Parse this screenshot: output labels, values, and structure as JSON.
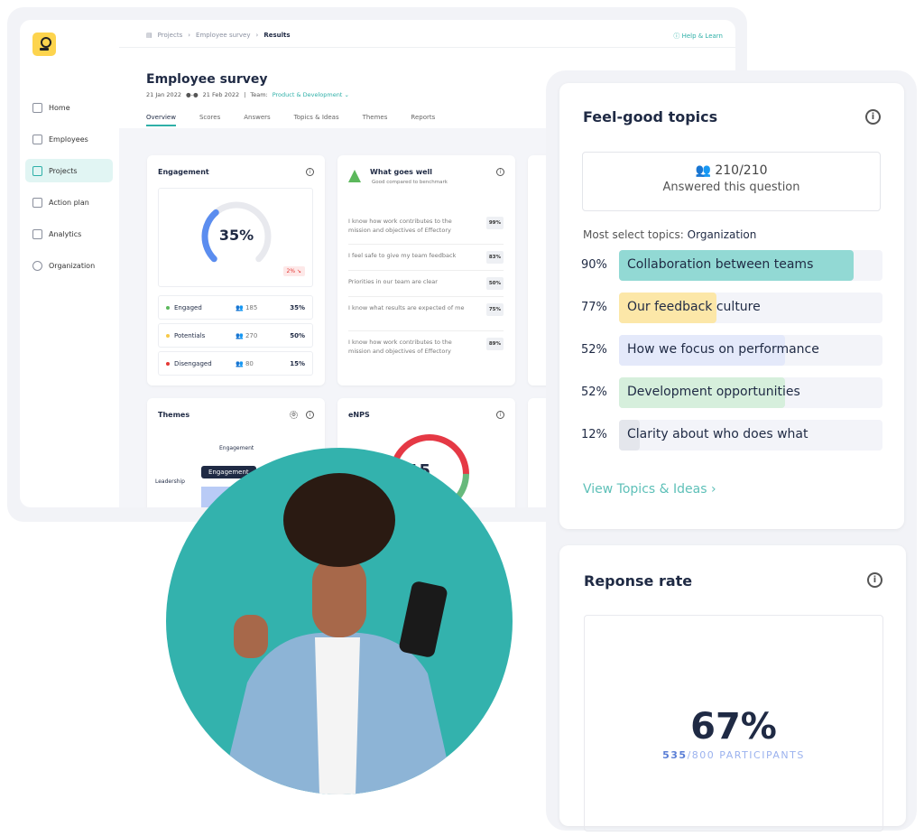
{
  "colors": {
    "accent": "#2fb0a8",
    "logo": "#fdd44e",
    "photo_bg": "#33b2ad"
  },
  "breadcrumb": [
    "Projects",
    "Employee survey",
    "Results"
  ],
  "help": "Help & Learn",
  "sidebar": {
    "items": [
      {
        "label": "Home",
        "icon": "home-icon"
      },
      {
        "label": "Employees",
        "icon": "employees-icon"
      },
      {
        "label": "Projects",
        "icon": "projects-icon",
        "active": true
      },
      {
        "label": "Action plan",
        "icon": "checklist-icon"
      },
      {
        "label": "Analytics",
        "icon": "analytics-icon"
      },
      {
        "label": "Organization",
        "icon": "organization-icon"
      }
    ]
  },
  "page": {
    "title": "Employee survey",
    "date_start": "21 Jan 2022",
    "date_end": "21 Feb 2022",
    "team_label": "Team:",
    "team": "Product & Development"
  },
  "tabs": [
    "Overview",
    "Scores",
    "Answers",
    "Topics & Ideas",
    "Themes",
    "Reports"
  ],
  "engagement": {
    "title": "Engagement",
    "value": "35%",
    "value_num": 35,
    "change": "2%",
    "rows": [
      {
        "label": "Engaged",
        "count": "185",
        "pct": "35%",
        "color": "#5cb85c"
      },
      {
        "label": "Potentials",
        "count": "270",
        "pct": "50%",
        "color": "#f7c948"
      },
      {
        "label": "Disengaged",
        "count": "80",
        "pct": "15%",
        "color": "#e53935"
      }
    ]
  },
  "what_goes_well": {
    "title": "What goes well",
    "subtitle": "Good compared to benchmark",
    "items": [
      {
        "text": "I know how work contributes to the mission and objectives of Effectory",
        "score": "99%"
      },
      {
        "text": "I feel safe to give my team feedback",
        "score": "83%"
      },
      {
        "text": "Priorities in our team are clear",
        "score": "50%"
      },
      {
        "text": "I know what results are expected of me",
        "score": "75%"
      },
      {
        "text": "I know how work contributes to the mission and objectives of Effectory",
        "score": "89%"
      }
    ]
  },
  "themes": {
    "title": "Themes",
    "axis_top": "Engagement",
    "axis_left": "Leadership",
    "tooltip": "Engagement"
  },
  "enps": {
    "title": "eNPS",
    "value": "15"
  },
  "feel_good": {
    "title": "Feel-good topics",
    "answered": "210/210",
    "answered_label": "Answered this question",
    "most_label": "Most select topics:",
    "most_value": "Organization",
    "topics": [
      {
        "pct": "90%",
        "label": "Collaboration between teams",
        "fill": 0.89,
        "color": "#92d9d4"
      },
      {
        "pct": "77%",
        "label": "Our feedback culture",
        "fill": 0.37,
        "color": "#fce7a8"
      },
      {
        "pct": "52%",
        "label": "How we focus on performance",
        "fill": 0.63,
        "color": "#e4e9fa"
      },
      {
        "pct": "52%",
        "label": "Development opportunities",
        "fill": 0.63,
        "color": "#d6efdc"
      },
      {
        "pct": "12%",
        "label": "Clarity about who does what",
        "fill": 0.08,
        "color": "#e4e6ec"
      }
    ],
    "link": "View Topics & Ideas"
  },
  "response": {
    "title": "Reponse rate",
    "value": "67%",
    "count": "535",
    "total": "/800 PARTICIPANTS"
  }
}
